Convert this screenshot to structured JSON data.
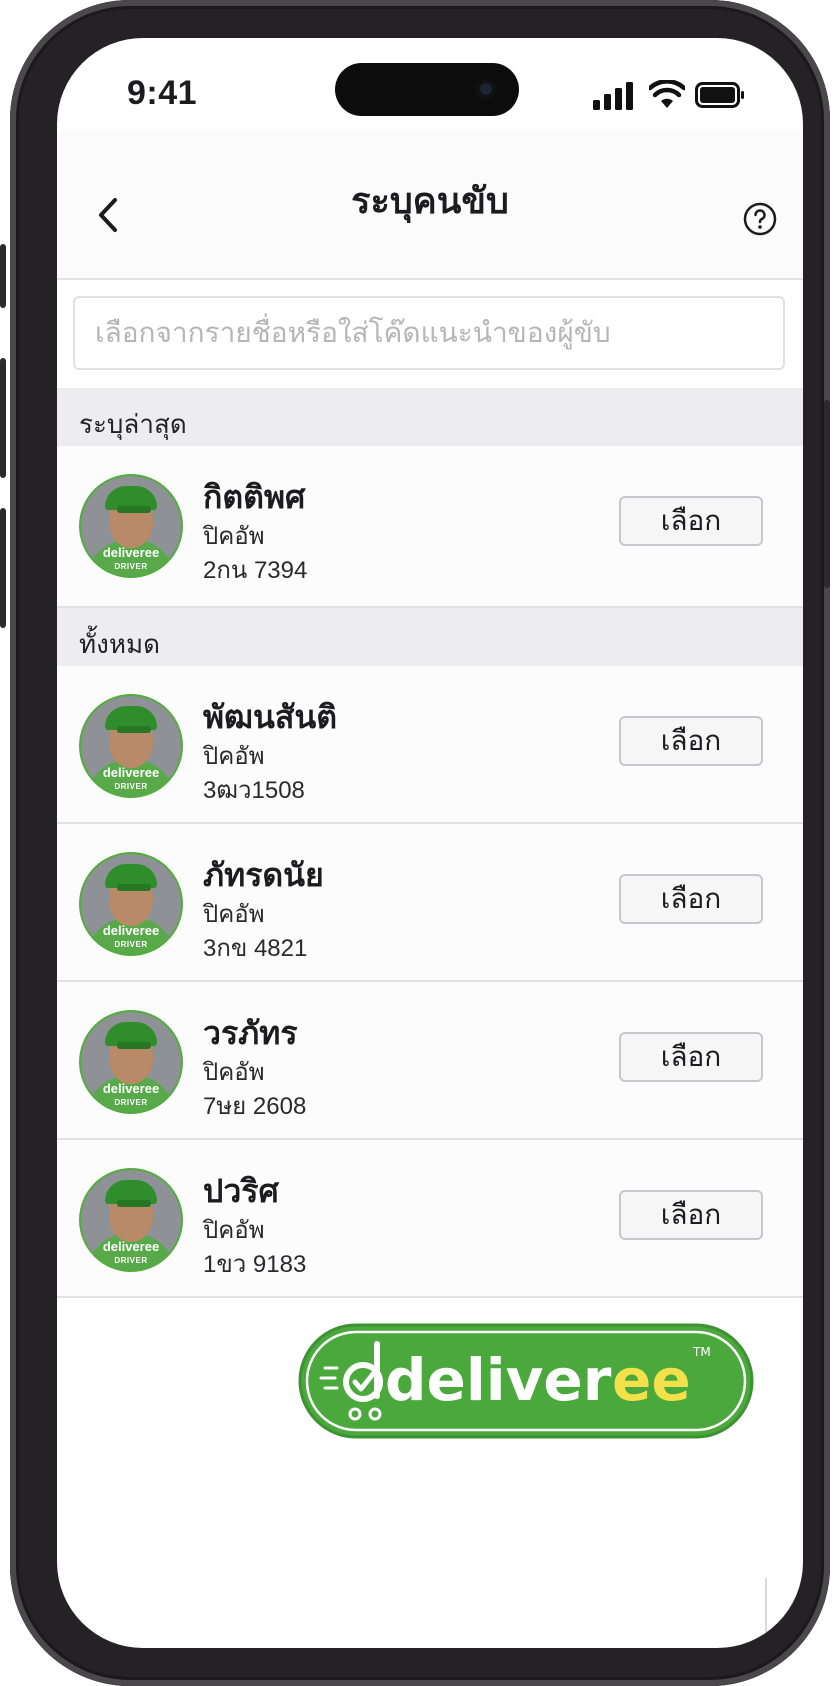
{
  "status_bar": {
    "time": "9:41"
  },
  "header": {
    "title": "ระบุคนขับ"
  },
  "search": {
    "placeholder": "เลือกจากรายชื่อหรือใส่โค๊ดแนะนำของผู้ขับ"
  },
  "sections": {
    "recent": "ระบุล่าสุด",
    "all": "ทั้งหมด"
  },
  "recent_drivers": [
    {
      "name": "กิตติพศ",
      "vehicle_type": "ปิคอัพ",
      "plate": "2กน 7394",
      "button": "เลือก"
    }
  ],
  "all_drivers": [
    {
      "name": "พัฒนสันติ",
      "vehicle_type": "ปิคอัพ",
      "plate": "3ฒว1508",
      "button": "เลือก"
    },
    {
      "name": "ภัทรดนัย",
      "vehicle_type": "ปิคอัพ",
      "plate": "3กข 4821",
      "button": "เลือก"
    },
    {
      "name": "วรภัทร",
      "vehicle_type": "ปิคอัพ",
      "plate": "7ษย 2608",
      "button": "เลือก"
    },
    {
      "name": "ปวริศ",
      "vehicle_type": "ปิคอัพ",
      "plate": "1ขว 9183",
      "button": "เลือก"
    }
  ],
  "avatar_badge": {
    "brand": "deliveree",
    "role": "DRIVER"
  },
  "logo": {
    "text_dark": "deliver",
    "text_accent": "ee",
    "tm": "TM"
  },
  "colors": {
    "brand_green": "#4aa83c",
    "brand_yellow": "#f2e14b",
    "section_bg": "#ededf0"
  }
}
